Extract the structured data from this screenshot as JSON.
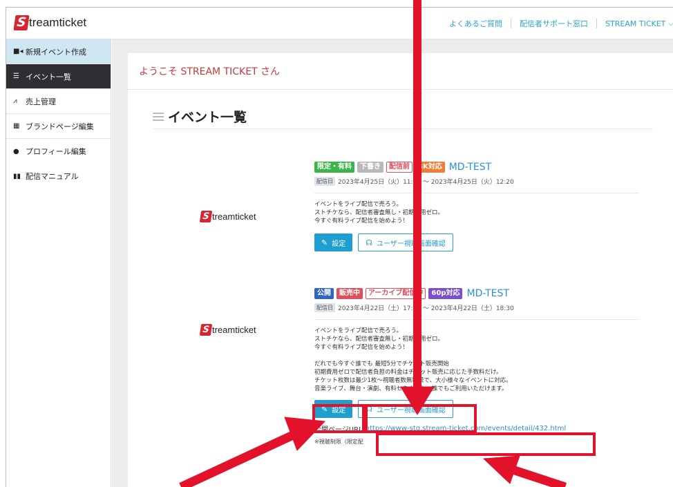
{
  "header": {
    "logo_mark": "S",
    "logo_text": "treamticket",
    "nav": [
      "よくあるご質問",
      "配信者サポート窓口",
      "STREAM TICKET"
    ],
    "account_chevron": "chevron-down-icon"
  },
  "sidebar": {
    "items": [
      {
        "label": "新規イベント作成",
        "icon": "video-camera-icon"
      },
      {
        "label": "イベント一覧",
        "icon": "list-icon"
      },
      {
        "label": "売上管理",
        "icon": "chart-icon"
      },
      {
        "label": "ブランドページ編集",
        "icon": "grid-icon"
      },
      {
        "label": "プロフィール編集",
        "icon": "user-icon"
      },
      {
        "label": "配信マニュアル",
        "icon": "book-icon"
      }
    ]
  },
  "main": {
    "welcome": "ようこそ STREAM TICKET さん",
    "list_title": "イベント一覧"
  },
  "events": [
    {
      "logo_mark": "S",
      "logo_text": "treamticket",
      "badges": [
        {
          "label": "限定・有料",
          "color": "#3cb44b"
        },
        {
          "label": "下書き",
          "color": "#b9b9b9"
        },
        {
          "label": "配信前",
          "color": "#e0505a"
        },
        {
          "label": "4K対応",
          "color": "#f07d3a"
        }
      ],
      "name": "MD-TEST",
      "date_tag": "配信日",
      "date": "2023年4月25日（火）11:20 〜 2023年4月25日（火）12:20",
      "desc": [
        "イベントをライブ配信で売ろう。",
        "ストチケなら、配信者審査無し・初期費用ゼロ。",
        "今すぐ有料ライブ配信を始めよう！"
      ],
      "settings_label": "設定",
      "view_label": "ユーザー視聴画面確認"
    },
    {
      "logo_mark": "S",
      "logo_text": "treamticket",
      "badges": [
        {
          "label": "公開",
          "color": "#2e66c8"
        },
        {
          "label": "販売中",
          "color": "#e0505a"
        },
        {
          "label": "アーカイブ配信中",
          "color": "#e0505a"
        },
        {
          "label": "60p対応",
          "color": "#7b4fd0"
        }
      ],
      "name": "MD-TEST",
      "date_tag": "配信日",
      "date": "2023年4月22日（土）17:30 〜 2023年4月22日（土）18:30",
      "desc": [
        "イベントをライブ配信で売ろう。",
        "ストチケなら、配信者審査無し・初期費用ゼロ。",
        "今すぐ有料ライブ配信を始めよう！"
      ],
      "desc2": [
        "だれでも今すぐ誰でも 最短5分でチケット販売開始",
        "初期費用ゼロで配信者負担の料金はチケット販売に応じた手数料だけ。",
        "チケット枚数は最少1枚〜視聴者数無制限で、大小様々なイベントに対応。",
        "音楽ライブ、舞台・演劇、有料セミナーも。誰でもご利用いただけます。"
      ],
      "settings_label": "設定",
      "view_label": "ユーザー視聴画面確認",
      "url_label": "公開ページURL",
      "url": "https://www-stg.stream-ticket.com/events/detail/432.html",
      "note": "※視聴制限（限定配"
    }
  ],
  "annotation_color": "#e2122a"
}
